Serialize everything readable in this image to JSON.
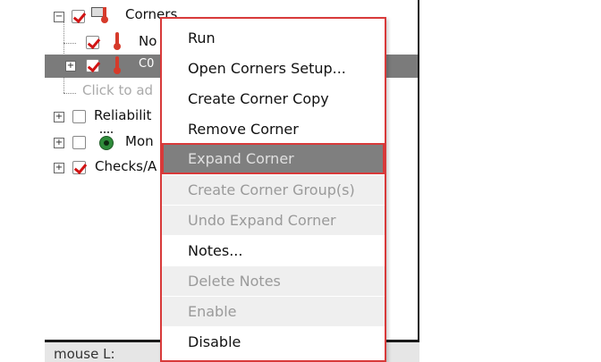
{
  "tree": {
    "rows": [
      {
        "label": "Corners",
        "checked": true,
        "expander": "−",
        "icon": "corners-icon"
      },
      {
        "label": "No",
        "checked": true,
        "icon": "thermometer-icon"
      },
      {
        "label": "C0",
        "checked": true,
        "expander": "+",
        "icon": "thermometer-icon",
        "selected": true
      },
      {
        "label": "Click to ad",
        "hint": true
      },
      {
        "label": "Reliabilit",
        "checked": false,
        "expander": "+"
      },
      {
        "label": "Mon",
        "checked": false,
        "expander": "+",
        "icon": "monitor-icon"
      },
      {
        "label": "Checks/A",
        "checked": true,
        "expander": "+"
      }
    ]
  },
  "status_bar": {
    "text": "mouse L:"
  },
  "context_menu": {
    "items": [
      {
        "label": "Run",
        "state": "enabled"
      },
      {
        "label": "Open Corners Setup...",
        "state": "enabled"
      },
      {
        "label": "Create Corner Copy",
        "state": "enabled"
      },
      {
        "label": "Remove Corner",
        "state": "enabled"
      },
      {
        "label": "Expand Corner",
        "state": "highlighted"
      },
      {
        "label": "Create Corner Group(s)",
        "state": "disabled"
      },
      {
        "label": "Undo Expand Corner",
        "state": "disabled"
      },
      {
        "label": "Notes...",
        "state": "enabled"
      },
      {
        "label": "Delete Notes",
        "state": "disabled"
      },
      {
        "label": "Enable",
        "state": "disabled"
      },
      {
        "label": "Disable",
        "state": "enabled"
      }
    ]
  },
  "colors": {
    "accent_border": "#d83a3a",
    "checkmark": "#d11414",
    "selected_row": "#7b7b7b"
  }
}
